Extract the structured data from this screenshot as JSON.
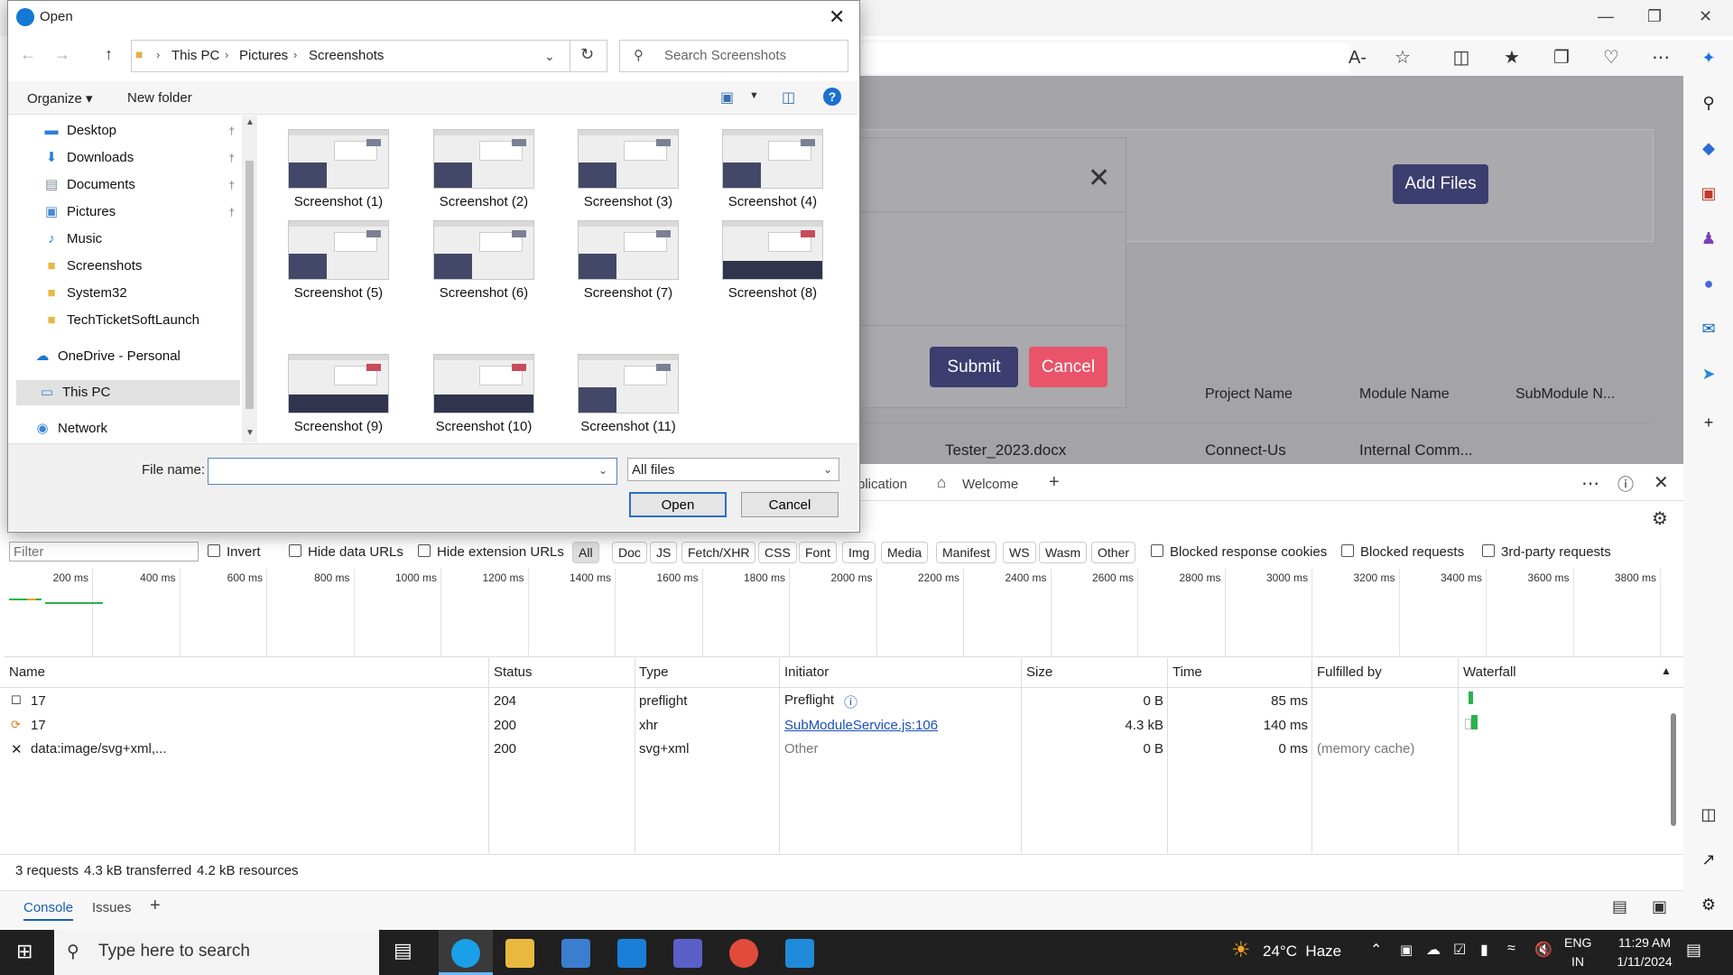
{
  "dialog": {
    "title": "Open",
    "breadcrumb": [
      "This PC",
      "Pictures",
      "Screenshots"
    ],
    "search_placeholder": "Search Screenshots",
    "organize_label": "Organize ▾",
    "new_folder_label": "New folder",
    "nav_items": [
      {
        "label": "Desktop",
        "icon": "desktop-icon",
        "pinned": true
      },
      {
        "label": "Downloads",
        "icon": "download-icon",
        "pinned": true
      },
      {
        "label": "Documents",
        "icon": "document-icon",
        "pinned": true
      },
      {
        "label": "Pictures",
        "icon": "picture-icon",
        "pinned": true
      },
      {
        "label": "Music",
        "icon": "music-icon",
        "pinned": false
      },
      {
        "label": "Screenshots",
        "icon": "folder-icon",
        "pinned": false
      },
      {
        "label": "System32",
        "icon": "folder-icon",
        "pinned": false
      },
      {
        "label": "TechTicketSoftLaunch",
        "icon": "folder-icon",
        "pinned": false
      },
      {
        "label": "OneDrive - Personal",
        "icon": "cloud-icon",
        "pinned": false
      },
      {
        "label": "This PC",
        "icon": "computer-icon",
        "pinned": false
      },
      {
        "label": "Network",
        "icon": "network-icon",
        "pinned": false
      }
    ],
    "files": [
      "Screenshot (1)",
      "Screenshot (2)",
      "Screenshot (3)",
      "Screenshot (4)",
      "Screenshot (5)",
      "Screenshot (6)",
      "Screenshot (7)",
      "Screenshot (8)",
      "Screenshot (9)",
      "Screenshot (10)",
      "Screenshot (11)"
    ],
    "file_name_label": "File name:",
    "file_name_value": "",
    "file_type_value": "All files",
    "open_label": "Open",
    "cancel_label": "Cancel"
  },
  "page": {
    "add_files_label": "Add Files",
    "submit_label": "Submit",
    "cancel_label": "Cancel",
    "columns": [
      "Project Name",
      "Module Name",
      "SubModule N..."
    ],
    "row": [
      "Tester_2023.docx",
      "Connect-Us",
      "Internal Comm..."
    ]
  },
  "devtools": {
    "tab_partial": "plication",
    "welcome_tab": "Welcome",
    "filter_placeholder": "Filter",
    "checkboxes": [
      "Invert",
      "Hide data URLs",
      "Hide extension URLs"
    ],
    "type_filters": [
      "All",
      "Doc",
      "JS",
      "Fetch/XHR",
      "CSS",
      "Font",
      "Img",
      "Media",
      "Manifest",
      "WS",
      "Wasm",
      "Other"
    ],
    "checkboxes_right": [
      "Blocked response cookies",
      "Blocked requests",
      "3rd-party requests"
    ],
    "ticks": [
      "200 ms",
      "400 ms",
      "600 ms",
      "800 ms",
      "1000 ms",
      "1200 ms",
      "1400 ms",
      "1600 ms",
      "1800 ms",
      "2000 ms",
      "2200 ms",
      "2400 ms",
      "2600 ms",
      "2800 ms",
      "3000 ms",
      "3200 ms",
      "3400 ms",
      "3600 ms",
      "3800 ms"
    ],
    "columns": [
      "Name",
      "Status",
      "Type",
      "Initiator",
      "Size",
      "Time",
      "Fulfilled by",
      "Waterfall"
    ],
    "rows": [
      {
        "name": "17",
        "status": "204",
        "type": "preflight",
        "initiator": "Preflight",
        "size": "0 B",
        "time": "85 ms",
        "fulfilled": ""
      },
      {
        "name": "17",
        "status": "200",
        "type": "xhr",
        "initiator": "SubModuleService.js:106",
        "size": "4.3 kB",
        "time": "140 ms",
        "fulfilled": ""
      },
      {
        "name": "data:image/svg+xml,...",
        "status": "200",
        "type": "svg+xml",
        "initiator": "Other",
        "size": "0 B",
        "time": "0 ms",
        "fulfilled": "(memory cache)"
      }
    ],
    "summary": [
      "3 requests",
      "4.3 kB transferred",
      "4.2 kB resources"
    ],
    "bottom_tabs": [
      "Console",
      "Issues"
    ]
  },
  "taskbar": {
    "search_placeholder": "Type here to search",
    "weather": "24°C  Haze",
    "lang": [
      "ENG",
      "IN"
    ],
    "time": "11:29 AM",
    "date": "1/11/2024"
  }
}
